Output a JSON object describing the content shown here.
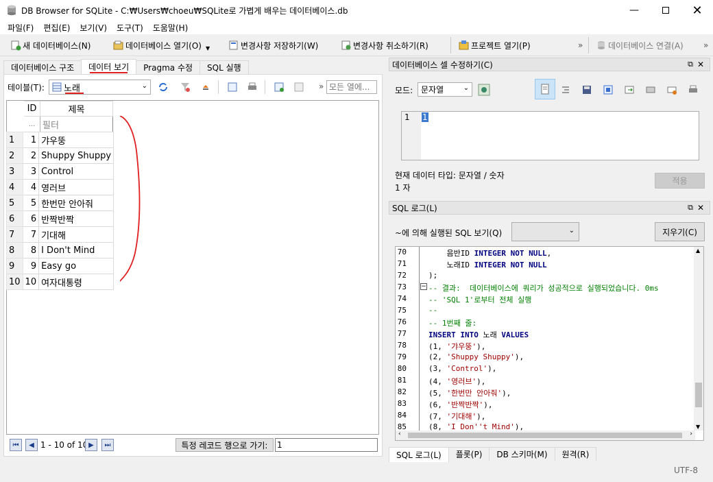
{
  "window": {
    "title": "DB Browser for SQLite - C:₩Users₩choeu₩SQLite로 가볍게 배우는 데이터베이스.db"
  },
  "menu": [
    "파일(F)",
    "편집(E)",
    "보기(V)",
    "도구(T)",
    "도움말(H)"
  ],
  "toolbar": {
    "new_db": "새 데이터베이스(N)",
    "open_db": "데이터베이스 열기(O)",
    "save": "변경사항 저장하기(W)",
    "revert": "변경사항 취소하기(R)",
    "open_project": "프로젝트 열기(P)",
    "attach": "데이터베이스 연결(A)",
    "overflow1": "»",
    "overflow2": "»"
  },
  "main_tabs": [
    "데이터베이스 구조",
    "데이터 보기",
    "Pragma 수정",
    "SQL 실행"
  ],
  "browse": {
    "table_label": "테이블(T):",
    "table_value": "노래",
    "filter_placeholder": "모든 열에...",
    "overflow": "»",
    "columns": [
      "ID",
      "제목"
    ],
    "filter_dots": "...",
    "filter_text": "필터",
    "rows": [
      {
        "rn": "1",
        "id": "1",
        "title": "갸우뚱"
      },
      {
        "rn": "2",
        "id": "2",
        "title": "Shuppy Shuppy"
      },
      {
        "rn": "3",
        "id": "3",
        "title": "Control"
      },
      {
        "rn": "4",
        "id": "4",
        "title": "영러브"
      },
      {
        "rn": "5",
        "id": "5",
        "title": "한번만 안아줘"
      },
      {
        "rn": "6",
        "id": "6",
        "title": "반짝반짝"
      },
      {
        "rn": "7",
        "id": "7",
        "title": "기대해"
      },
      {
        "rn": "8",
        "id": "8",
        "title": "I Don't Mind"
      },
      {
        "rn": "9",
        "id": "9",
        "title": "Easy go"
      },
      {
        "rn": "10",
        "id": "10",
        "title": "여자대통령"
      }
    ],
    "page_info": "1 - 10 of 10",
    "goto_label": "특정 레코드 행으로 가기:",
    "goto_value": "1"
  },
  "edit_cell": {
    "title": "데이터베이스 셀 수정하기(C)",
    "mode_label": "모드:",
    "mode_value": "문자열",
    "line_no": "1",
    "cell_value": "1",
    "type_info": "현재 데이터 타입: 문자열 / 숫자",
    "size_info": "1 자",
    "apply": "적용"
  },
  "sql_log": {
    "title": "SQL 로그(L)",
    "filter_label": "~에 의해 실행된 SQL 보기(Q)",
    "clear": "지우기(C)",
    "lines": [
      {
        "n": "70",
        "t": "    음반ID INTEGER NOT NULL,"
      },
      {
        "n": "71",
        "t": "    노래ID INTEGER NOT NULL"
      },
      {
        "n": "72",
        "t": ");"
      },
      {
        "n": "73",
        "t": "-- 결과:  데이터베이스에 쿼리가 성공적으로 실행되었습니다. 0ms"
      },
      {
        "n": "74",
        "t": "-- 'SQL 1'로부터 전체 실행"
      },
      {
        "n": "75",
        "t": "--"
      },
      {
        "n": "76",
        "t": "-- 1번째 줄:"
      },
      {
        "n": "77",
        "t": "INSERT INTO 노래 VALUES"
      },
      {
        "n": "78",
        "t": "(1, '갸우뚱'),"
      },
      {
        "n": "79",
        "t": "(2, 'Shuppy Shuppy'),"
      },
      {
        "n": "80",
        "t": "(3, 'Control'),"
      },
      {
        "n": "81",
        "t": "(4, '영러브'),"
      },
      {
        "n": "82",
        "t": "(5, '한번만 안아줘'),"
      },
      {
        "n": "83",
        "t": "(6, '반짝반짝'),"
      },
      {
        "n": "84",
        "t": "(7, '기대해'),"
      },
      {
        "n": "85",
        "t": "(8, 'I Don''t Mind'),"
      }
    ]
  },
  "bottom_tabs": [
    "SQL 로그(L)",
    "플롯(P)",
    "DB 스키마(M)",
    "원격(R)"
  ],
  "status": {
    "encoding": "UTF-8"
  }
}
